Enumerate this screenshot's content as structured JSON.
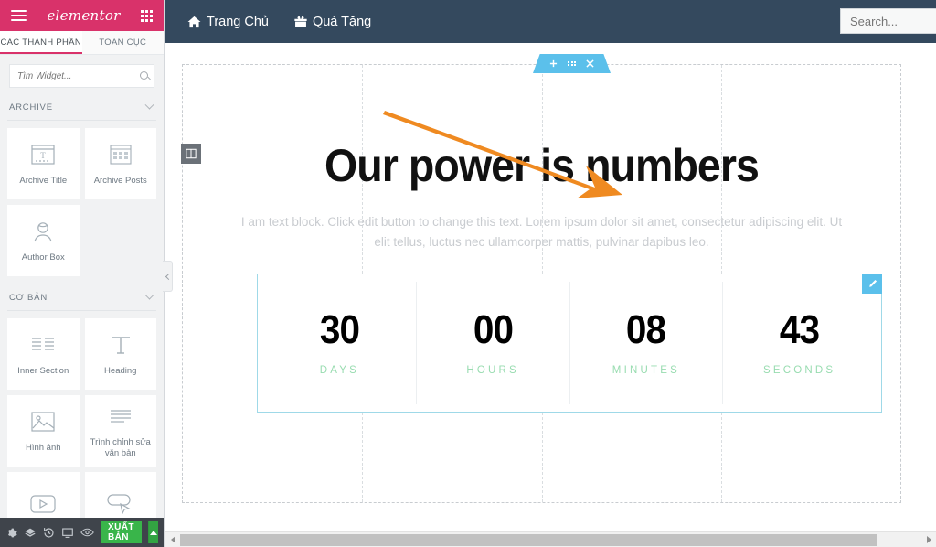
{
  "panel": {
    "header": {
      "logo": "elementor",
      "menu_icon": "hamburger-icon",
      "apps_icon": "grid-icon"
    },
    "tabs": [
      {
        "label": "CÁC THÀNH PHẦN",
        "active": true
      },
      {
        "label": "TOÀN CỤC",
        "active": false
      }
    ],
    "search": {
      "placeholder": "Tìm Widget...",
      "value": "",
      "icon": "search-icon"
    },
    "categories": [
      {
        "name": "ARCHIVE",
        "widgets": [
          {
            "label": "Archive Title",
            "icon": "archive-title-icon"
          },
          {
            "label": "Archive Posts",
            "icon": "archive-posts-icon"
          },
          {
            "label": "Author Box",
            "icon": "author-box-icon"
          }
        ]
      },
      {
        "name": "CƠ BẢN",
        "widgets": [
          {
            "label": "Inner Section",
            "icon": "inner-section-icon"
          },
          {
            "label": "Heading",
            "icon": "heading-icon"
          },
          {
            "label": "Hình ảnh",
            "icon": "image-icon"
          },
          {
            "label": "Trình chỉnh sửa văn bản",
            "icon": "text-editor-icon"
          },
          {
            "label": "",
            "icon": "video-icon"
          },
          {
            "label": "",
            "icon": "button-icon"
          }
        ]
      }
    ],
    "footer": {
      "icons": [
        "settings-gear-icon",
        "navigator-layers-icon",
        "history-icon",
        "responsive-mode-icon",
        "preview-eye-icon"
      ],
      "publish_label": "XUẤT BẢN",
      "publish_color": "#39b54a",
      "caret_icon": "caret-up-icon"
    },
    "collapse_icon": "chevron-left-icon"
  },
  "site": {
    "navbar": {
      "background": "#34495e",
      "items": [
        {
          "label": "Trang Chủ",
          "icon": "home-icon"
        },
        {
          "label": "Quà Tặng",
          "icon": "gift-icon"
        }
      ],
      "search": {
        "placeholder": "Search...",
        "value": ""
      }
    },
    "section_toolbar": {
      "add_icon": "plus-icon",
      "drag_icon": "drag-dots-icon",
      "close_icon": "close-x-icon",
      "color": "#5bc0eb"
    },
    "column_handle_icon": "columns-icon",
    "hero": {
      "title": "Our power is numbers",
      "paragraph_line1": "I am text block. Click edit button to change this text. Lorem ipsum dolor sit amet, consectetur adipiscing elit.",
      "paragraph_line2": "Ut elit tellus, luctus nec ullamcorper mattis, pulvinar dapibus leo."
    },
    "countdown": {
      "edit_icon": "pencil-edit-icon",
      "selection_color": "#9fd9e8",
      "label_color": "#98dcb0",
      "cells": [
        {
          "value": "30",
          "label": "DAYS"
        },
        {
          "value": "00",
          "label": "HOURS"
        },
        {
          "value": "08",
          "label": "MINUTES"
        },
        {
          "value": "43",
          "label": "SECONDS"
        }
      ]
    },
    "annotation": {
      "type": "arrow",
      "color": "#ef8a21"
    }
  },
  "scrollbar": {
    "left_icon": "scroll-left-arrow",
    "right_icon": "scroll-right-arrow"
  }
}
